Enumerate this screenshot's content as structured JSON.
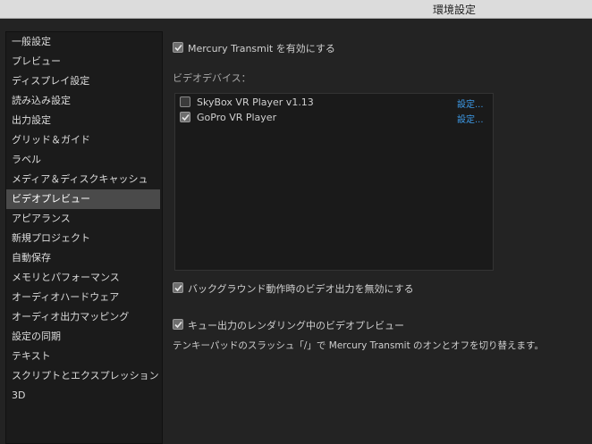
{
  "window": {
    "title": "環境設定"
  },
  "sidebar": {
    "selected_index": 8,
    "items": [
      {
        "label": "一般設定"
      },
      {
        "label": "プレビュー"
      },
      {
        "label": "ディスプレイ設定"
      },
      {
        "label": "読み込み設定"
      },
      {
        "label": "出力設定"
      },
      {
        "label": "グリッド＆ガイド"
      },
      {
        "label": "ラベル"
      },
      {
        "label": "メディア＆ディスクキャッシュ"
      },
      {
        "label": "ビデオプレビュー"
      },
      {
        "label": "アピアランス"
      },
      {
        "label": "新規プロジェクト"
      },
      {
        "label": "自動保存"
      },
      {
        "label": "メモリとパフォーマンス"
      },
      {
        "label": "オーディオハードウェア"
      },
      {
        "label": "オーディオ出力マッピング"
      },
      {
        "label": "設定の同期"
      },
      {
        "label": "テキスト"
      },
      {
        "label": "スクリプトとエクスプレッション"
      },
      {
        "label": "3D"
      }
    ]
  },
  "main": {
    "enable_transmit": {
      "label": "Mercury Transmit を有効にする",
      "checked": true
    },
    "video_devices_label": "ビデオデバイス：",
    "devices": [
      {
        "name": "SkyBox VR Player v1.13",
        "checked": false,
        "settings_label": "設定..."
      },
      {
        "name": "GoPro VR Player",
        "checked": true,
        "settings_label": "設定..."
      }
    ],
    "disable_background": {
      "label": "バックグラウンド動作時のビデオ出力を無効にする",
      "checked": true
    },
    "cue_preview": {
      "label": "キュー出力のレンダリング中のビデオプレビュー",
      "checked": true
    },
    "description": "テンキーパッドのスラッシュ「/」で Mercury Transmit のオンとオフを切り替えます。"
  }
}
